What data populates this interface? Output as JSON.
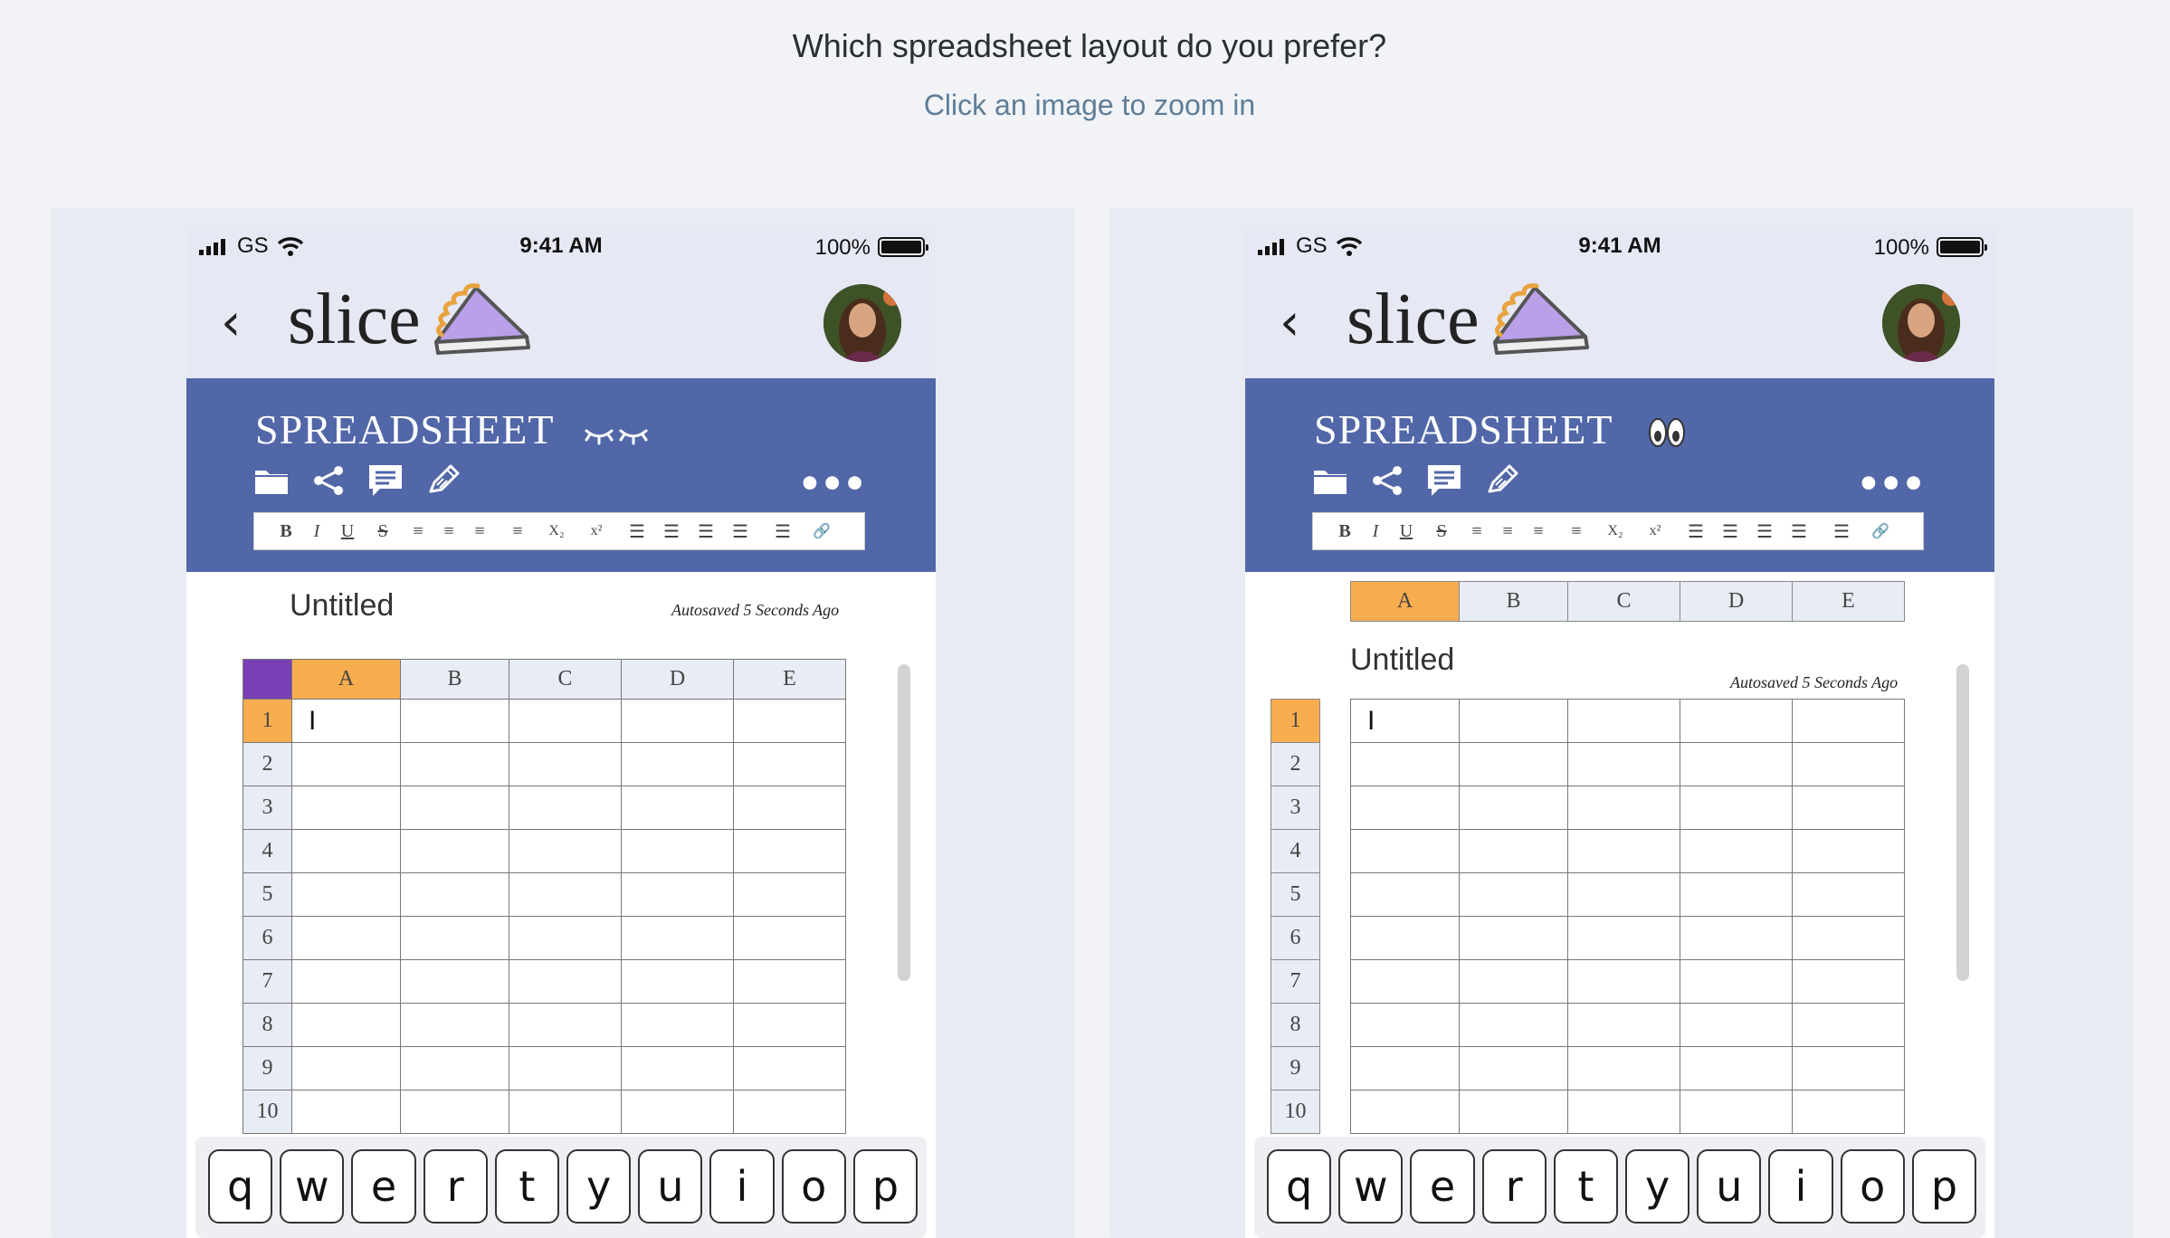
{
  "header": {
    "question": "Which spreadsheet layout do you prefer?",
    "hint": "Click an image to zoom in"
  },
  "status": {
    "carrier": "GS",
    "time": "9:41 AM",
    "battery": "100%"
  },
  "app": {
    "back": "‹",
    "logo": "slice",
    "sheet_title": "SPREADSHEET",
    "more": "•••"
  },
  "format": [
    "B",
    "I",
    "U",
    "S",
    "≡",
    "≡",
    "≡",
    "≡",
    "X₂",
    "x²",
    "☰",
    "☰",
    "☰",
    "☰",
    "☰",
    "🔗"
  ],
  "doc": {
    "title": "Untitled",
    "autosave": "Autosaved 5 Seconds Ago",
    "cursor": "I"
  },
  "columns": [
    "A",
    "B",
    "C",
    "D",
    "E"
  ],
  "rows": [
    "1",
    "2",
    "3",
    "4",
    "5",
    "6",
    "7",
    "8",
    "9",
    "10"
  ],
  "keys": [
    "q",
    "w",
    "e",
    "r",
    "t",
    "y",
    "u",
    "i",
    "o",
    "p"
  ]
}
